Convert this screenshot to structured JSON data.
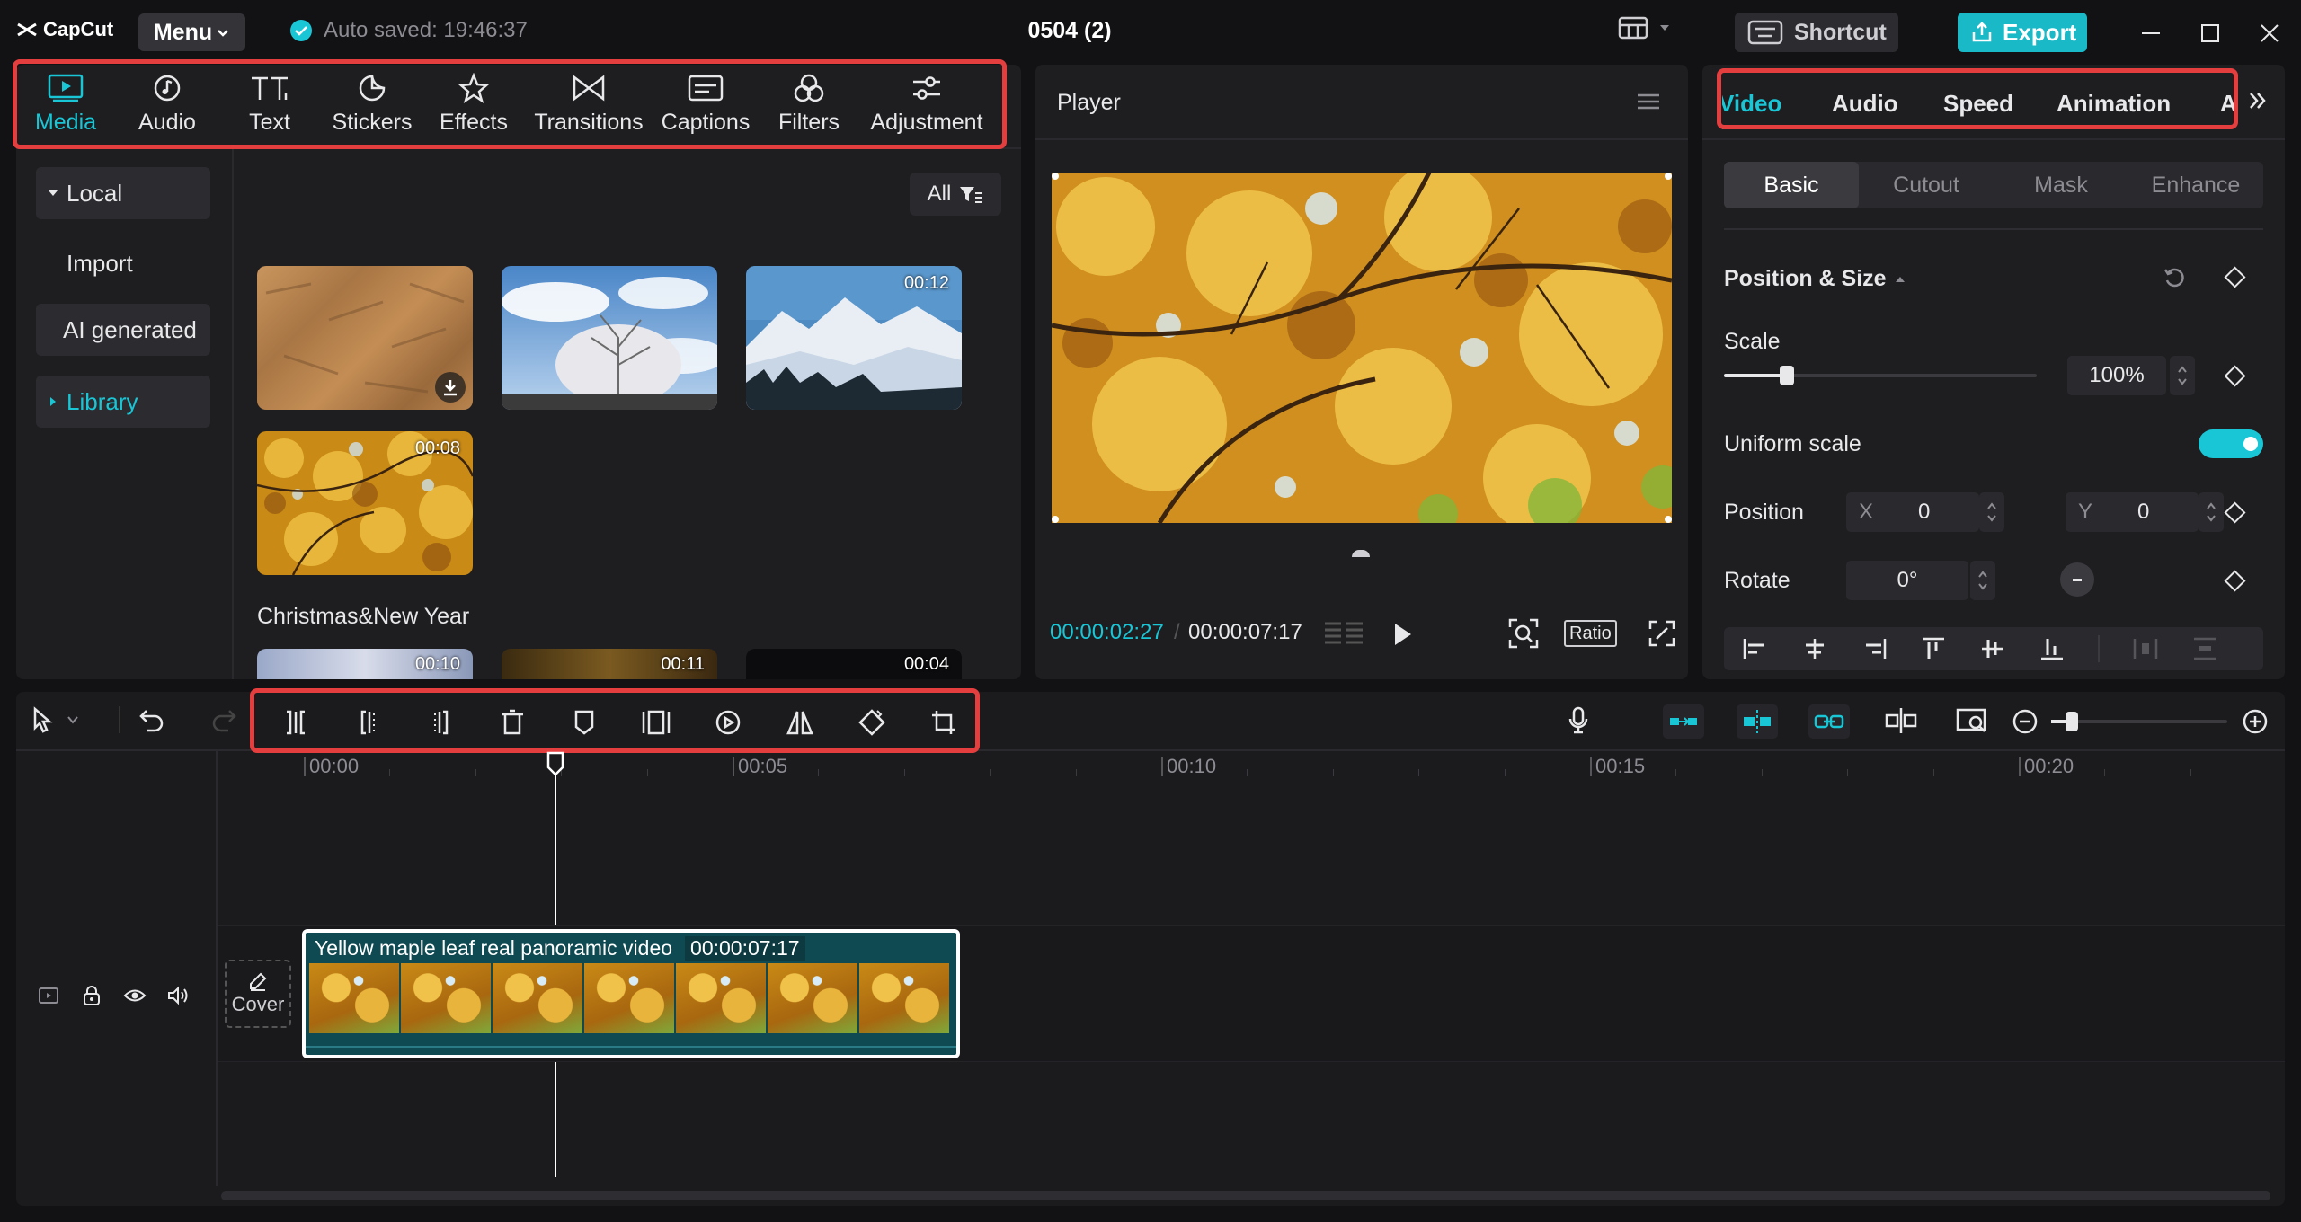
{
  "app": {
    "logo_text": "CapCut",
    "menu_label": "Menu",
    "autosave_text": "Auto saved: 19:46:37",
    "project_title": "0504 (2)",
    "shortcut_label": "Shortcut",
    "export_label": "Export"
  },
  "media_tabs": [
    {
      "label": "Media",
      "icon": "media-icon",
      "active": true
    },
    {
      "label": "Audio",
      "icon": "audio-icon"
    },
    {
      "label": "Text",
      "icon": "text-icon"
    },
    {
      "label": "Stickers",
      "icon": "stickers-icon"
    },
    {
      "label": "Effects",
      "icon": "effects-icon"
    },
    {
      "label": "Transitions",
      "icon": "transitions-icon"
    },
    {
      "label": "Captions",
      "icon": "captions-icon"
    },
    {
      "label": "Filters",
      "icon": "filters-icon"
    },
    {
      "label": "Adjustment",
      "icon": "adjustment-icon"
    }
  ],
  "sidebar": {
    "local": "Local",
    "import": "Import",
    "ai_generated": "AI generated",
    "library": "Library"
  },
  "media": {
    "filter_label": "All",
    "thumbs": [
      {
        "duration": "",
        "name": "wood texture"
      },
      {
        "duration": "",
        "name": "frosty tree sky"
      },
      {
        "duration": "00:12",
        "name": "snowy mountains"
      },
      {
        "duration": "00:08",
        "name": "yellow maple leaves"
      }
    ],
    "section_title": "Christmas&New Year",
    "section_thumbs": [
      {
        "duration": "00:10"
      },
      {
        "duration": "00:11"
      },
      {
        "duration": "00:04"
      }
    ]
  },
  "player": {
    "label": "Player",
    "current_time": "00:00:02:27",
    "total_time": "00:00:07:17",
    "ratio_label": "Ratio"
  },
  "properties": {
    "tabs": [
      "Video",
      "Audio",
      "Speed",
      "Animation",
      "A"
    ],
    "subtabs": [
      "Basic",
      "Cutout",
      "Mask",
      "Enhance"
    ],
    "section": "Position & Size",
    "scale_label": "Scale",
    "scale_value": "100%",
    "scale_fraction": 0.2,
    "uniform_label": "Uniform scale",
    "uniform_on": true,
    "position_label": "Position",
    "pos_x_label": "X",
    "pos_x": "0",
    "pos_y_label": "Y",
    "pos_y": "0",
    "rotate_label": "Rotate",
    "rotate_value": "0°"
  },
  "timeline": {
    "ruler": [
      "00:00",
      "00:05",
      "00:10",
      "00:15",
      "00:20"
    ],
    "clip_title": "Yellow maple leaf real panoramic video",
    "clip_duration": "00:00:07:17",
    "cover_label": "Cover"
  },
  "colors": {
    "accent": "#19c6d6",
    "highlight": "#e53e3e",
    "export": "#19b9c7"
  }
}
